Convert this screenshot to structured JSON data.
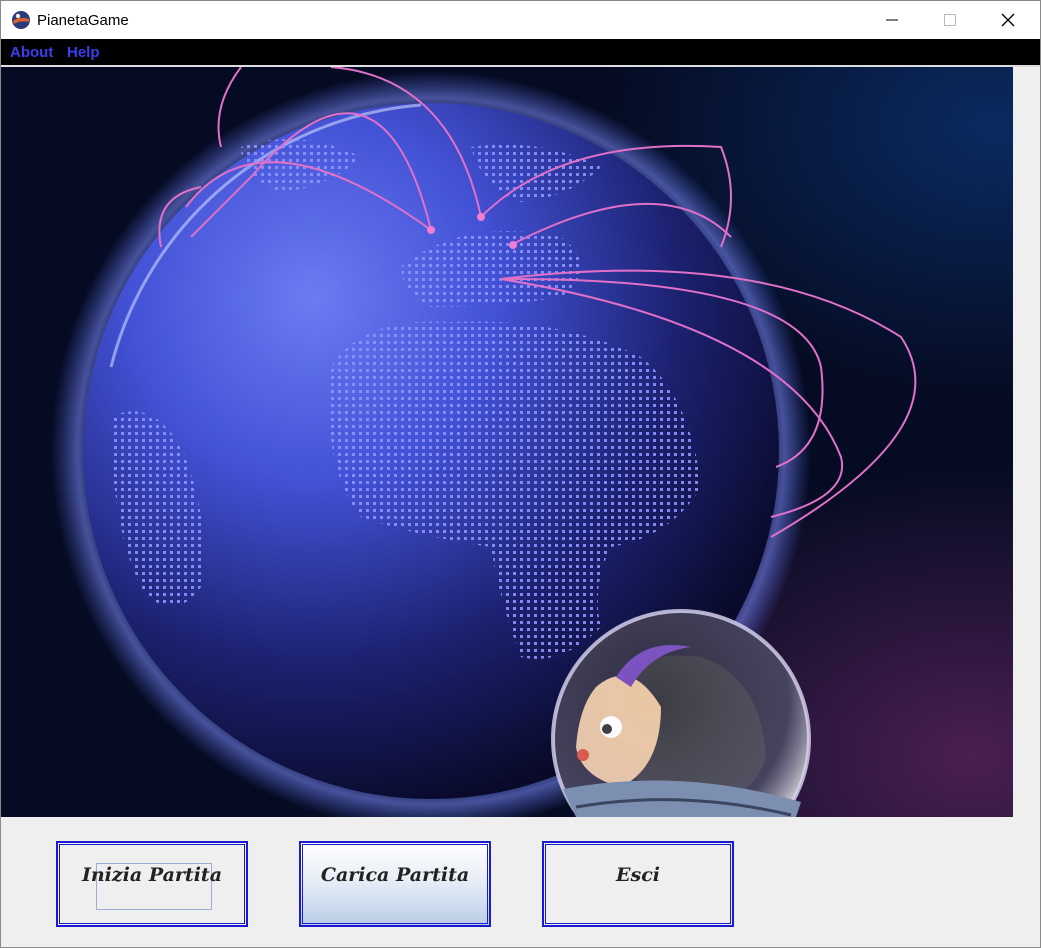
{
  "window": {
    "title": "PianetaGame",
    "controls": {
      "minimize": "minimize",
      "maximize": "maximize",
      "close": "close"
    }
  },
  "menu": {
    "items": [
      {
        "label": "About"
      },
      {
        "label": "Help"
      }
    ]
  },
  "buttons": {
    "new_game": "Inizia Partita",
    "load_game": "Carica Partita",
    "exit": "Esci"
  },
  "colors": {
    "menu_text": "#3d3df0",
    "button_border": "#1b1bd0",
    "planet": "#4a5be0",
    "arcs": "#e070c8"
  }
}
